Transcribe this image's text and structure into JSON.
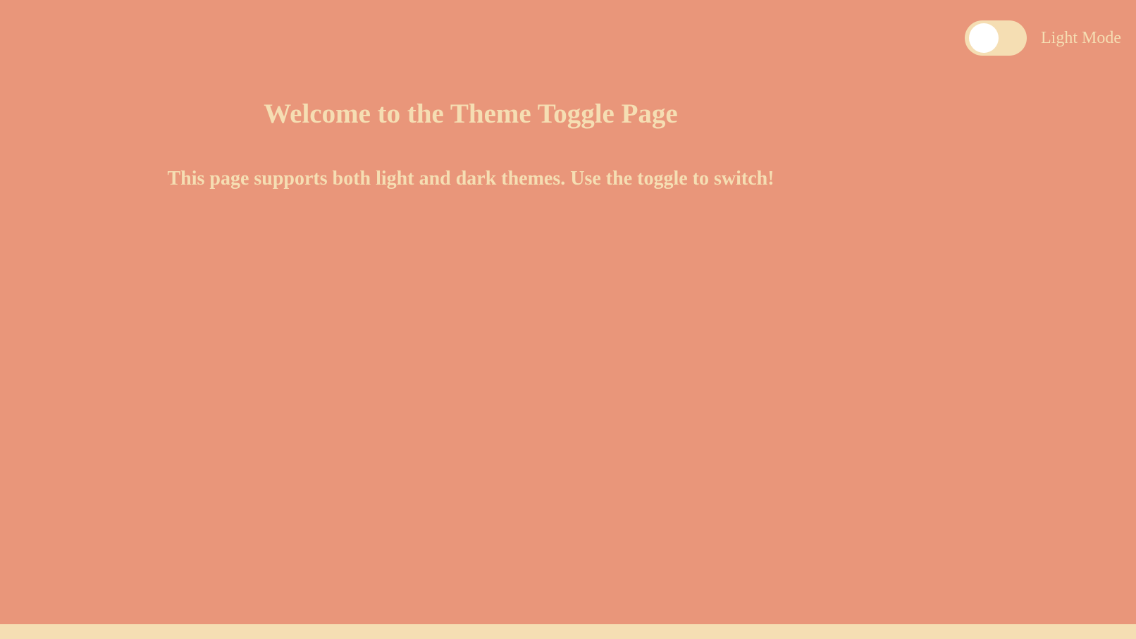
{
  "theme": {
    "background": "#E9967A",
    "text": "#F5DEB3",
    "accent": "#F5DEB3",
    "knob": "#FFFFFF"
  },
  "toggle": {
    "label": "Light Mode",
    "state": "off"
  },
  "main": {
    "title": "Welcome to the Theme Toggle Page",
    "description": "This page supports both light and dark themes. Use the toggle to switch!"
  }
}
